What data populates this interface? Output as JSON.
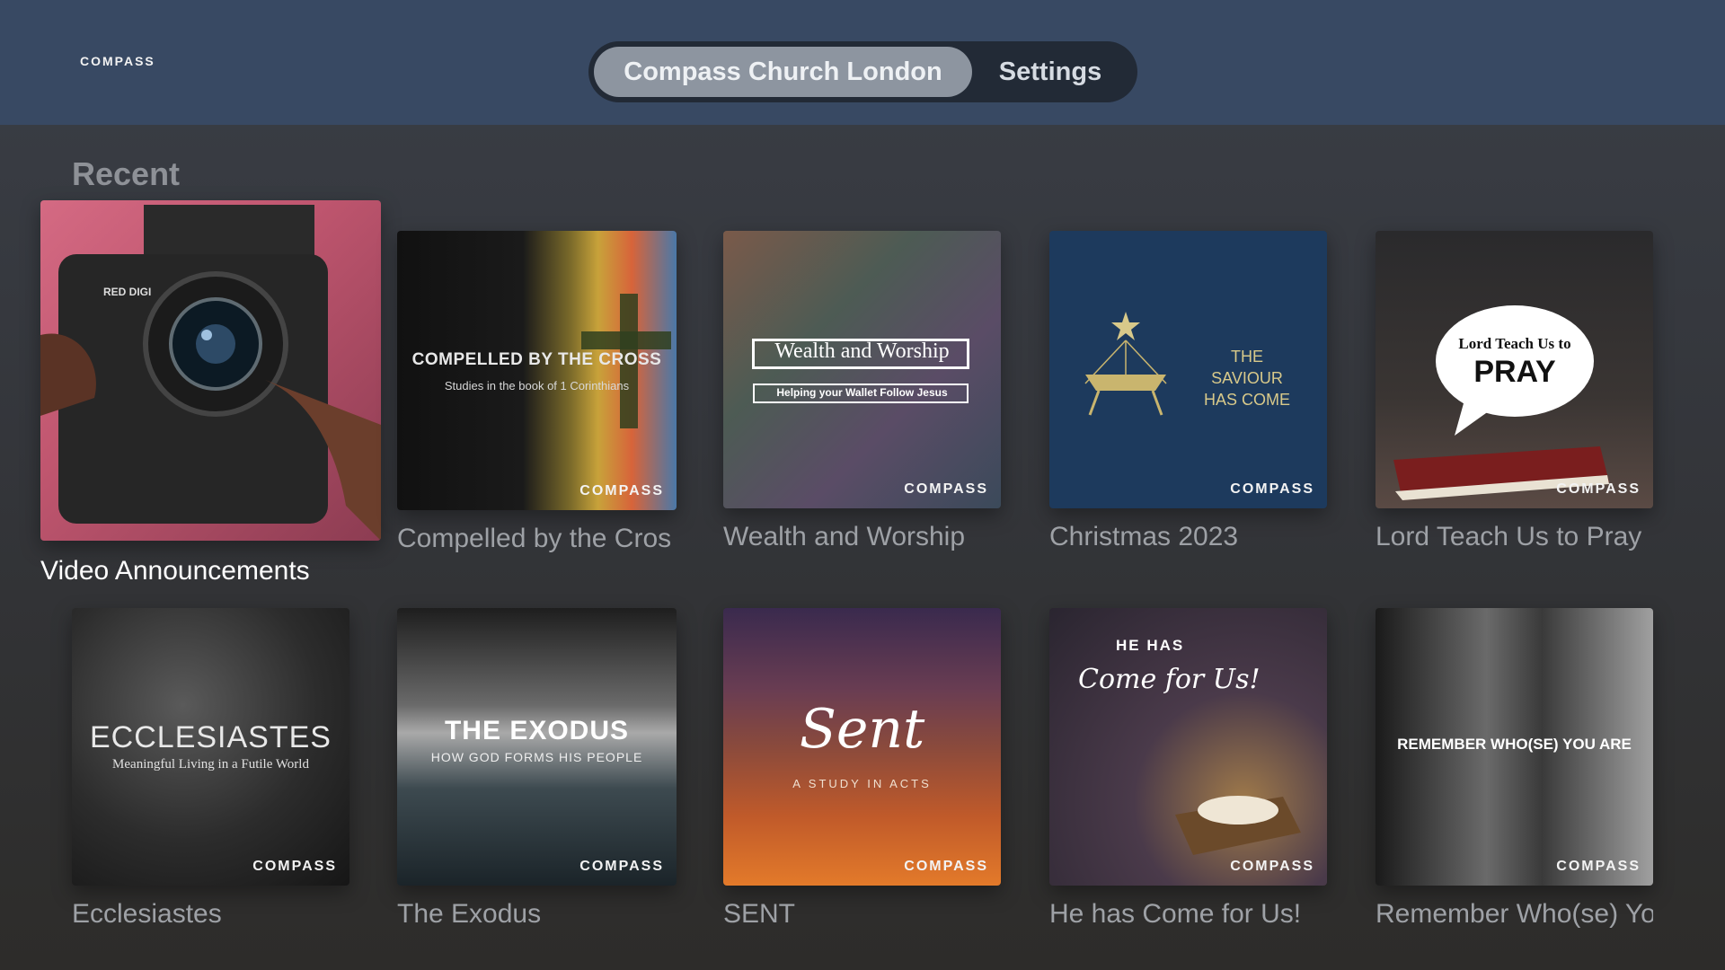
{
  "brand": {
    "logo": "COMPASS"
  },
  "tabs": [
    {
      "label": "Compass Church London",
      "active": true
    },
    {
      "label": "Settings",
      "active": false
    }
  ],
  "section_title": "Recent",
  "watermark": "COMPASS",
  "cards": [
    {
      "label": "Video Announcements",
      "focused": true,
      "art_text": {
        "camera": "RED DIGI"
      }
    },
    {
      "label": "Compelled by the Cros",
      "art_text": {
        "title": "COMPELLED BY THE CROSS",
        "subtitle": "Studies in the book of 1 Corinthians"
      }
    },
    {
      "label": "Wealth and Worship",
      "art_text": {
        "title": "Wealth and Worship",
        "subtitle": "Helping your Wallet Follow Jesus"
      }
    },
    {
      "label": "Christmas 2023",
      "art_text": {
        "title": "THE SAVIOUR HAS COME"
      }
    },
    {
      "label": "Lord Teach Us to Pray",
      "art_text": {
        "title": "Lord Teach Us to",
        "title_big": "PRAY"
      }
    },
    {
      "label": "Ecclesiastes",
      "art_text": {
        "title": "ECCLESIASTES",
        "subtitle": "Meaningful Living in a Futile World"
      }
    },
    {
      "label": "The Exodus",
      "art_text": {
        "title": "THE EXODUS",
        "subtitle": "HOW GOD FORMS HIS PEOPLE"
      }
    },
    {
      "label": "SENT",
      "art_text": {
        "title": "Sent",
        "subtitle": "A STUDY IN ACTS"
      }
    },
    {
      "label": "He has Come for Us!",
      "art_text": {
        "title": "HE HAS",
        "title_script": "Come for Us!"
      }
    },
    {
      "label": "Remember Who(se) Yo",
      "art_text": {
        "title": "REMEMBER WHO(SE) YOU ARE"
      }
    }
  ]
}
